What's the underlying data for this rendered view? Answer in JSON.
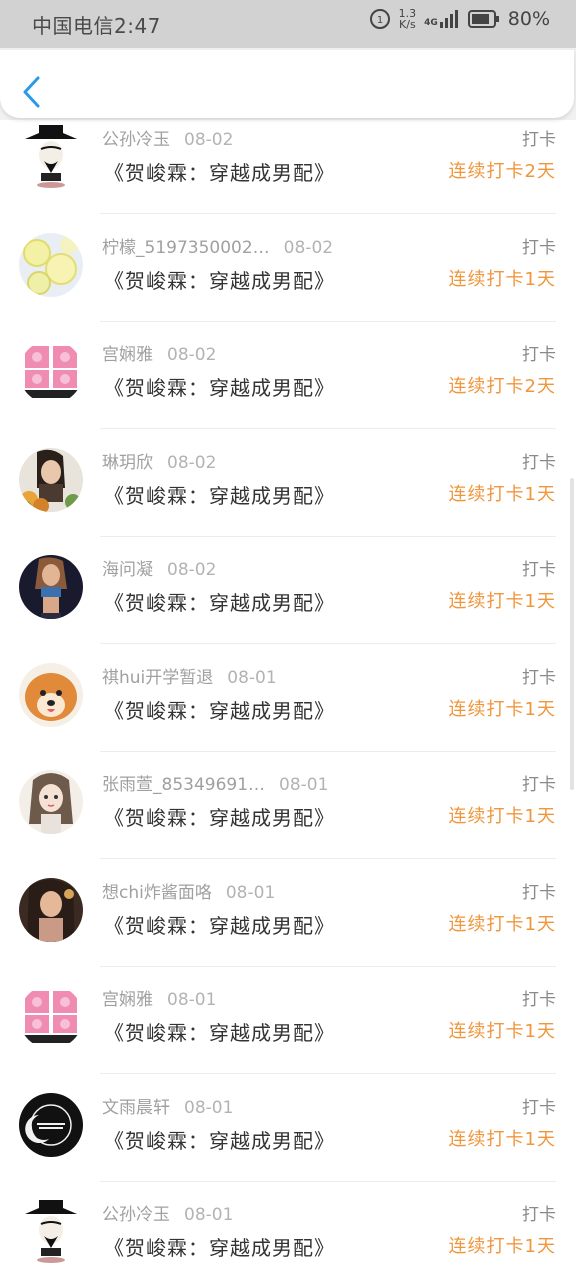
{
  "status_bar": {
    "carrier_time": "中国电信2:47",
    "speed_top": "1.3",
    "speed_unit": "K/s",
    "net_type": "4G",
    "battery": "80%"
  },
  "records": [
    {
      "name": "公孙冷玉",
      "date": "08-02",
      "book": "《贺峻霖：穿越成男配》",
      "tag": "打卡",
      "streak": "连续打卡2天",
      "avatar": "masked-figure-avatar"
    },
    {
      "name": "柠檬_5197350002…",
      "date": "08-02",
      "book": "《贺峻霖：穿越成男配》",
      "tag": "打卡",
      "streak": "连续打卡1天",
      "avatar": "lemon-avatar"
    },
    {
      "name": "宫娴雅",
      "date": "08-02",
      "book": "《贺峻霖：穿越成男配》",
      "tag": "打卡",
      "streak": "连续打卡2天",
      "avatar": "pink-panther-avatar"
    },
    {
      "name": "琳玥欣",
      "date": "08-02",
      "book": "《贺峻霖：穿越成男配》",
      "tag": "打卡",
      "streak": "连续打卡1天",
      "avatar": "girl-flowers-avatar"
    },
    {
      "name": "海问凝",
      "date": "08-02",
      "book": "《贺峻霖：穿越成男配》",
      "tag": "打卡",
      "streak": "连续打卡1天",
      "avatar": "fitness-girl-avatar"
    },
    {
      "name": "祺hui开学暂退",
      "date": "08-01",
      "book": "《贺峻霖：穿越成男配》",
      "tag": "打卡",
      "streak": "连续打卡1天",
      "avatar": "shiba-dog-avatar"
    },
    {
      "name": "张雨萱_85349691…",
      "date": "08-01",
      "book": "《贺峻霖：穿越成男配》",
      "tag": "打卡",
      "streak": "连续打卡1天",
      "avatar": "anime-girl-avatar"
    },
    {
      "name": "想chi炸酱面咯",
      "date": "08-01",
      "book": "《贺峻霖：穿越成男配》",
      "tag": "打卡",
      "streak": "连续打卡1天",
      "avatar": "girl-portrait-avatar"
    },
    {
      "name": "宫娴雅",
      "date": "08-01",
      "book": "《贺峻霖：穿越成男配》",
      "tag": "打卡",
      "streak": "连续打卡1天",
      "avatar": "pink-panther-avatar"
    },
    {
      "name": "文雨晨轩",
      "date": "08-01",
      "book": "《贺峻霖：穿越成男配》",
      "tag": "打卡",
      "streak": "连续打卡1天",
      "avatar": "moon-logo-avatar"
    },
    {
      "name": "公孙冷玉",
      "date": "08-01",
      "book": "《贺峻霖：穿越成男配》",
      "tag": "打卡",
      "streak": "连续打卡1天",
      "avatar": "masked-figure-avatar"
    }
  ]
}
